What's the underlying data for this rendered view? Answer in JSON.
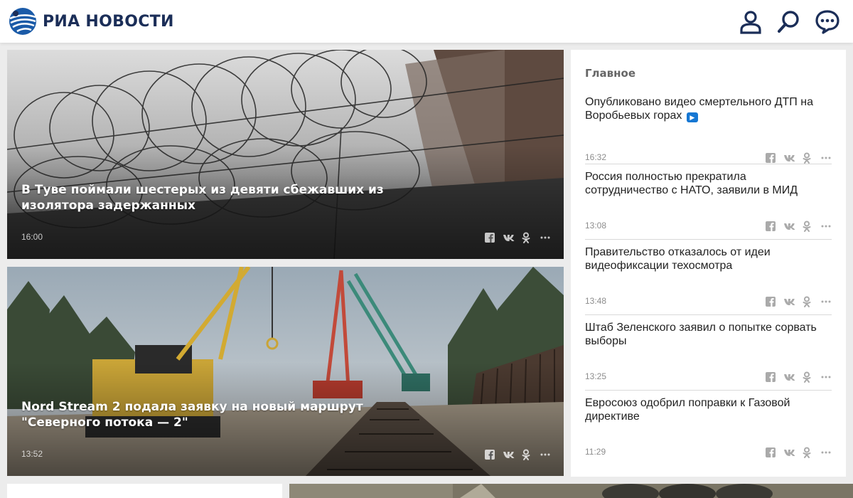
{
  "header": {
    "logo_text": "РИА НОВОСТИ",
    "icons": [
      "user-icon",
      "search-icon",
      "chat-icon"
    ],
    "brand_color": "#1b2e58"
  },
  "cards": [
    {
      "title": "В Туве поймали шестерых из девяти сбежавших из изолятора задержанных",
      "time": "16:00"
    },
    {
      "title": "Nord Stream 2 подала заявку на новый маршрут \"Северного потока — 2\"",
      "time": "13:52"
    }
  ],
  "sidebar": {
    "heading": "Главное",
    "items": [
      {
        "title": "Опубликовано видео смертельного ДТП на Воробьевых горах",
        "time": "16:32",
        "video": true
      },
      {
        "title": "Россия полностью прекратила сотрудничество с НАТО, заявили в МИД",
        "time": "13:08"
      },
      {
        "title": "Правительство отказалось от идеи видеофиксации техосмотра",
        "time": "13:48"
      },
      {
        "title": "Штаб Зеленского заявил о попытке сорвать выборы",
        "time": "13:25"
      },
      {
        "title": "Евросоюз одобрил поправки к Газовой директиве",
        "time": "11:29"
      }
    ]
  },
  "share_icons": [
    "facebook-icon",
    "vk-icon",
    "ok-icon",
    "more-icon"
  ],
  "colors": {
    "video_badge": "#1677d3",
    "background": "#ececec"
  }
}
